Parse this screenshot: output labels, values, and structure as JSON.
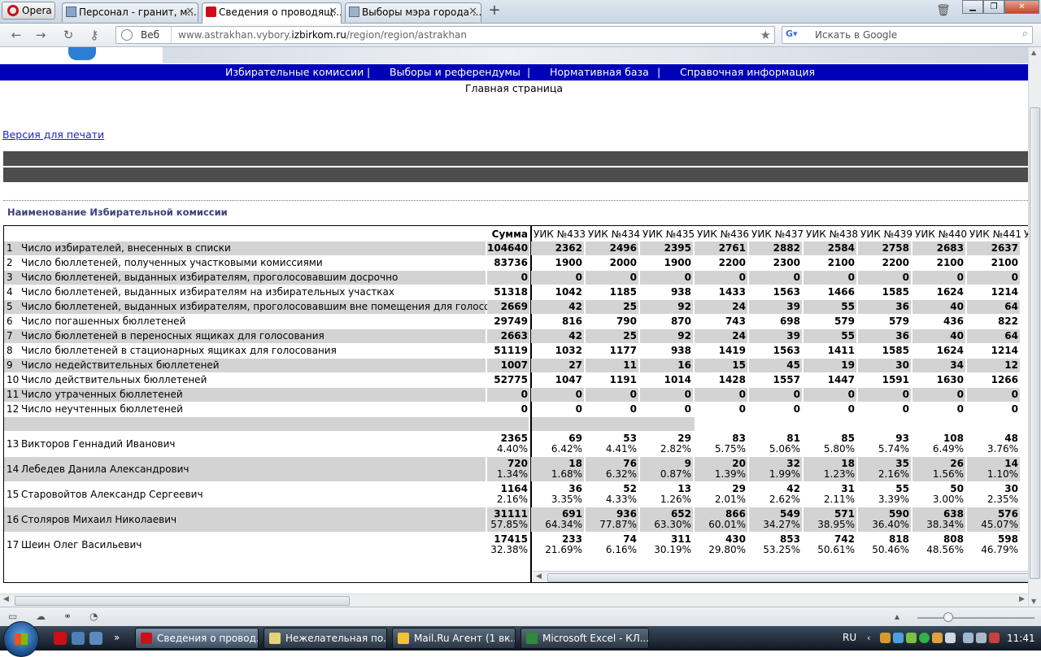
{
  "browser": {
    "menu_label": "Opera",
    "tabs": [
      {
        "title": "Персонал - гранит, м..."
      },
      {
        "title": "Сведения о проводящ..."
      },
      {
        "title": "Выборы мэра города ..."
      }
    ],
    "new_tab_symbol": "+",
    "close_symbol": "✕",
    "address_prefix": "Веб",
    "url_pre": "www.astrakhan.vybory.",
    "url_host": "izbirkom.ru",
    "url_post": "/region/region/astrakhan",
    "search_placeholder": "Искать в Google"
  },
  "site": {
    "nav": [
      {
        "label": "Избирательные комиссии"
      },
      {
        "label": "|"
      },
      {
        "label": "Выборы и референдумы"
      },
      {
        "label": "|"
      },
      {
        "label": "Нормативная база"
      },
      {
        "label": "|"
      },
      {
        "label": "Справочная информация"
      }
    ],
    "home": "Главная страница",
    "print_link": "Версия для печати",
    "commission_title": "Наименование Избирательной комиссии"
  },
  "table": {
    "sum_header": "Сумма",
    "columns": [
      "УИК №433",
      "УИК №434",
      "УИК №435",
      "УИК №436",
      "УИК №437",
      "УИК №438",
      "УИК №439",
      "УИК №440",
      "УИК №441",
      "У"
    ],
    "rows": [
      {
        "n": "1",
        "label": "Число избирателей, внесенных в списки",
        "sum": "104640",
        "vals": [
          "2362",
          "2496",
          "2395",
          "2761",
          "2882",
          "2584",
          "2758",
          "2683",
          "2637"
        ]
      },
      {
        "n": "2",
        "label": "Число бюллетеней, полученных участковыми комиссиями",
        "sum": "83736",
        "vals": [
          "1900",
          "2000",
          "1900",
          "2200",
          "2300",
          "2100",
          "2200",
          "2100",
          "2100"
        ]
      },
      {
        "n": "3",
        "label": "Число бюллетеней, выданных избирателям, проголосовавшим досрочно",
        "sum": "0",
        "vals": [
          "0",
          "0",
          "0",
          "0",
          "0",
          "0",
          "0",
          "0",
          "0"
        ]
      },
      {
        "n": "4",
        "label": "Число бюллетеней, выданных избирателям на избирательных участках",
        "sum": "51318",
        "vals": [
          "1042",
          "1185",
          "938",
          "1433",
          "1563",
          "1466",
          "1585",
          "1624",
          "1214"
        ]
      },
      {
        "n": "5",
        "label": "Число бюллетеней, выданных избирателям, проголосовавшим вне помещения для голосования",
        "sum": "2669",
        "vals": [
          "42",
          "25",
          "92",
          "24",
          "39",
          "55",
          "36",
          "40",
          "64"
        ]
      },
      {
        "n": "6",
        "label": "Число погашенных бюллетеней",
        "sum": "29749",
        "vals": [
          "816",
          "790",
          "870",
          "743",
          "698",
          "579",
          "579",
          "436",
          "822"
        ]
      },
      {
        "n": "7",
        "label": "Число бюллетеней в переносных ящиках для голосования",
        "sum": "2663",
        "vals": [
          "42",
          "25",
          "92",
          "24",
          "39",
          "55",
          "36",
          "40",
          "64"
        ]
      },
      {
        "n": "8",
        "label": "Число бюллетеней в стационарных ящиках для голосования",
        "sum": "51119",
        "vals": [
          "1032",
          "1177",
          "938",
          "1419",
          "1563",
          "1411",
          "1585",
          "1624",
          "1214"
        ]
      },
      {
        "n": "9",
        "label": "Число недействительных бюллетеней",
        "sum": "1007",
        "vals": [
          "27",
          "11",
          "16",
          "15",
          "45",
          "19",
          "30",
          "34",
          "12"
        ]
      },
      {
        "n": "10",
        "label": "Число действительных бюллетеней",
        "sum": "52775",
        "vals": [
          "1047",
          "1191",
          "1014",
          "1428",
          "1557",
          "1447",
          "1591",
          "1630",
          "1266"
        ]
      },
      {
        "n": "11",
        "label": "Число утраченных бюллетеней",
        "sum": "0",
        "vals": [
          "0",
          "0",
          "0",
          "0",
          "0",
          "0",
          "0",
          "0",
          "0"
        ]
      },
      {
        "n": "12",
        "label": "Число неучтенных бюллетеней",
        "sum": "0",
        "vals": [
          "0",
          "0",
          "0",
          "0",
          "0",
          "0",
          "0",
          "0",
          "0"
        ]
      }
    ],
    "candidates": [
      {
        "n": "13",
        "label": "Викторов Геннадий Иванович",
        "sum": "2365",
        "sum_pct": "4.40%",
        "vals": [
          "69",
          "53",
          "29",
          "83",
          "81",
          "85",
          "93",
          "108",
          "48"
        ],
        "pcts": [
          "6.42%",
          "4.41%",
          "2.82%",
          "5.75%",
          "5.06%",
          "5.80%",
          "5.74%",
          "6.49%",
          "3.76%"
        ]
      },
      {
        "n": "14",
        "label": "Лебедев Данила Александрович",
        "sum": "720",
        "sum_pct": "1.34%",
        "vals": [
          "18",
          "76",
          "9",
          "20",
          "32",
          "18",
          "35",
          "26",
          "14"
        ],
        "pcts": [
          "1.68%",
          "6.32%",
          "0.87%",
          "1.39%",
          "1.99%",
          "1.23%",
          "2.16%",
          "1.56%",
          "1.10%"
        ]
      },
      {
        "n": "15",
        "label": "Старовойтов Александр Сергеевич",
        "sum": "1164",
        "sum_pct": "2.16%",
        "vals": [
          "36",
          "52",
          "13",
          "29",
          "42",
          "31",
          "55",
          "50",
          "30"
        ],
        "pcts": [
          "3.35%",
          "4.33%",
          "1.26%",
          "2.01%",
          "2.62%",
          "2.11%",
          "3.39%",
          "3.00%",
          "2.35%"
        ]
      },
      {
        "n": "16",
        "label": "Столяров Михаил Николаевич",
        "sum": "31111",
        "sum_pct": "57.85%",
        "vals": [
          "691",
          "936",
          "652",
          "866",
          "549",
          "571",
          "590",
          "638",
          "576"
        ],
        "pcts": [
          "64.34%",
          "77.87%",
          "63.30%",
          "60.01%",
          "34.27%",
          "38.95%",
          "36.40%",
          "38.34%",
          "45.07%"
        ]
      },
      {
        "n": "17",
        "label": "Шеин Олег Васильевич",
        "sum": "17415",
        "sum_pct": "32.38%",
        "vals": [
          "233",
          "74",
          "311",
          "430",
          "853",
          "742",
          "818",
          "808",
          "598"
        ],
        "pcts": [
          "21.69%",
          "6.16%",
          "30.19%",
          "29.80%",
          "53.25%",
          "50.61%",
          "50.46%",
          "48.56%",
          "46.79%"
        ]
      }
    ]
  },
  "taskbar": {
    "tasks": [
      {
        "label": "Сведения о провод..."
      },
      {
        "label": "Нежелательная по..."
      },
      {
        "label": "Mail.Ru Агент (1 вк..."
      },
      {
        "label": "Microsoft Excel - КЛ..."
      }
    ],
    "lang": "RU",
    "clock": "11:41"
  },
  "colors": {
    "nav_bg": "#0000b8",
    "gray_row": "#d3d3d3",
    "dark_bar": "#4d4d4d",
    "link": "#1e1ec8"
  }
}
